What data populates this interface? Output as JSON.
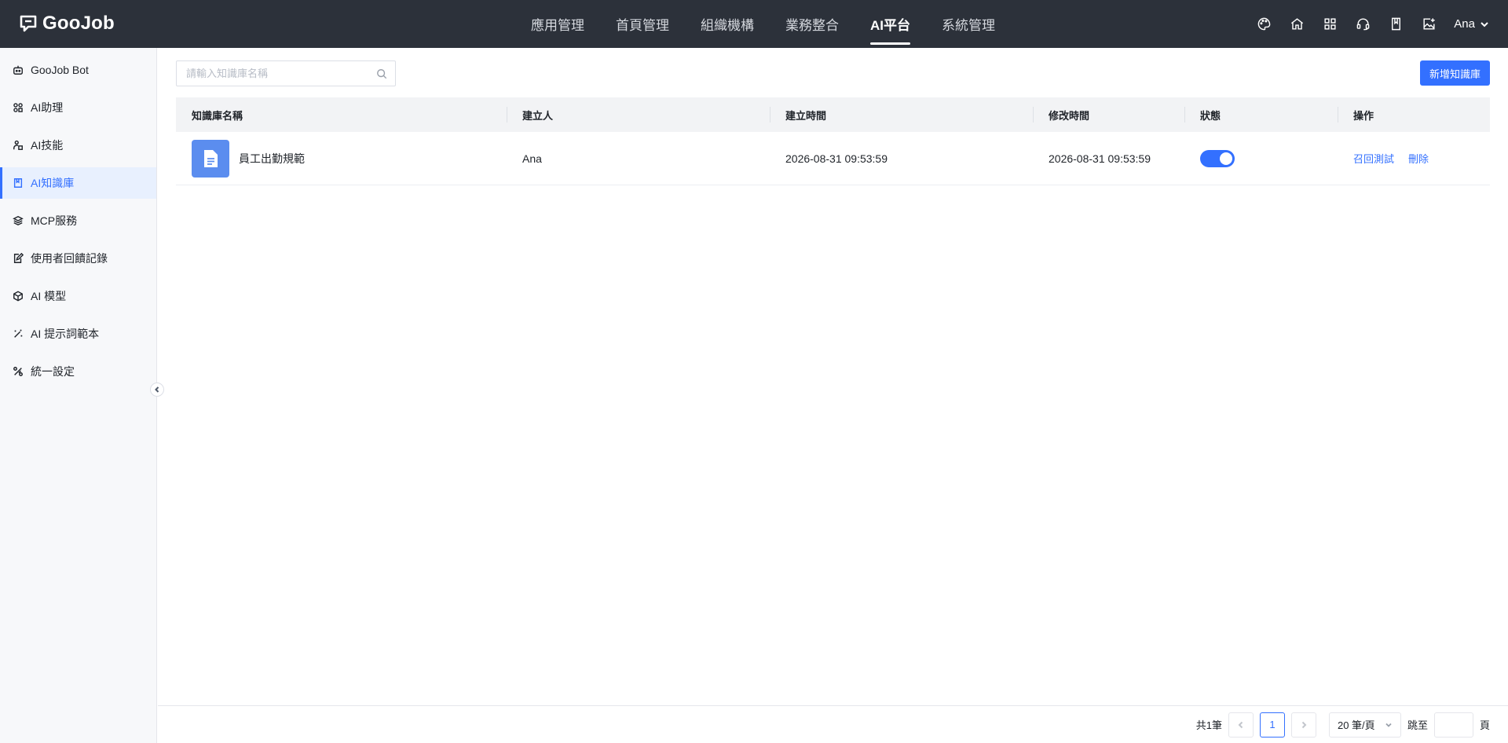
{
  "header": {
    "logo": "GooJob",
    "nav": [
      {
        "label": "應用管理",
        "active": false
      },
      {
        "label": "首頁管理",
        "active": false
      },
      {
        "label": "組織機構",
        "active": false
      },
      {
        "label": "業務整合",
        "active": false
      },
      {
        "label": "AI平台",
        "active": true
      },
      {
        "label": "系統管理",
        "active": false
      }
    ],
    "icons": [
      "palette-icon",
      "home-icon",
      "apps-grid-icon",
      "headset-icon",
      "book-icon",
      "image-add-icon"
    ],
    "user": "Ana"
  },
  "sidebar": {
    "items": [
      {
        "label": "GooJob Bot",
        "icon": "robot-icon",
        "active": false
      },
      {
        "label": "AI助理",
        "icon": "grid-assistant-icon",
        "active": false
      },
      {
        "label": "AI技能",
        "icon": "skill-icon",
        "active": false
      },
      {
        "label": "AI知識庫",
        "icon": "book-icon",
        "active": true
      },
      {
        "label": "MCP服務",
        "icon": "layers-icon",
        "active": false
      },
      {
        "label": "使用者回饋記錄",
        "icon": "feedback-icon",
        "active": false
      },
      {
        "label": "AI 模型",
        "icon": "cube-icon",
        "active": false
      },
      {
        "label": "AI 提示詞範本",
        "icon": "magic-wand-icon",
        "active": false
      },
      {
        "label": "統一設定",
        "icon": "tools-icon",
        "active": false
      }
    ]
  },
  "toolbar": {
    "search_placeholder": "請輸入知識庫名稱",
    "add_label": "新增知識庫"
  },
  "table": {
    "columns": [
      "知識庫名稱",
      "建立人",
      "建立時間",
      "修改時間",
      "狀態",
      "操作"
    ],
    "rows": [
      {
        "name": "員工出勤規範",
        "creator": "Ana",
        "created": "2026-08-31 09:53:59",
        "modified": "2026-08-31 09:53:59",
        "enabled": true,
        "actions": [
          "召回測試",
          "刪除"
        ]
      }
    ]
  },
  "pagination": {
    "total": "共1筆",
    "current_page": "1",
    "page_size": "20 筆/頁",
    "jump_label": "跳至",
    "page_suffix": "頁"
  },
  "colors": {
    "topbar": "#2c313a",
    "accent": "#3370ff",
    "sidebar_bg": "#f7f8fa",
    "doc_icon": "#5b8def"
  }
}
